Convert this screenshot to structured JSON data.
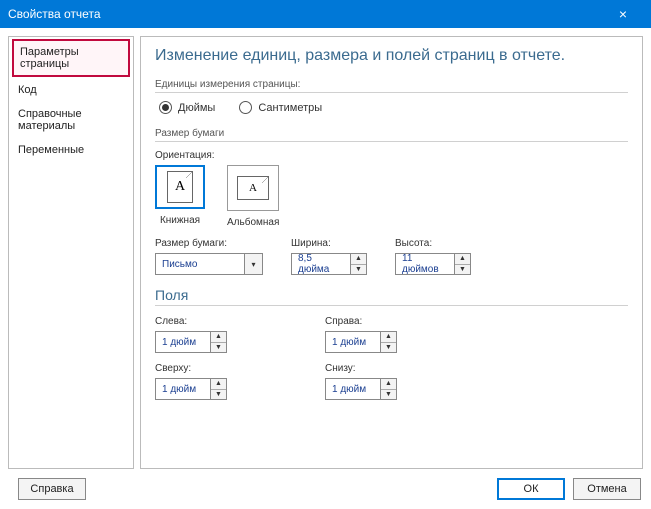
{
  "titlebar": {
    "title": "Свойства отчета"
  },
  "sidebar": {
    "items": [
      {
        "label": "Параметры страницы"
      },
      {
        "label": "Код"
      },
      {
        "label": "Справочные материалы"
      },
      {
        "label": "Переменные"
      }
    ]
  },
  "main": {
    "heading": "Изменение единиц, размера и полей страниц в отчете.",
    "units": {
      "group_label": "Единицы измерения страницы:",
      "inches": "Дюймы",
      "centimeters": "Сантиметры"
    },
    "paper": {
      "group_label": "Размер бумаги",
      "orientation_label": "Ориентация:",
      "portrait": "Книжная",
      "landscape": "Альбомная",
      "size_label": "Размер бумаги:",
      "size_value": "Письмо",
      "width_label": "Ширина:",
      "width_value": "8,5 дюйма",
      "height_label": "Высота:",
      "height_value": "11 дюймов"
    },
    "margins": {
      "title": "Поля",
      "left_label": "Слева:",
      "left_value": "1 дюйм",
      "right_label": "Справа:",
      "right_value": "1 дюйм",
      "top_label": "Сверху:",
      "top_value": "1 дюйм",
      "bottom_label": "Снизу:",
      "bottom_value": "1 дюйм"
    }
  },
  "footer": {
    "help": "Справка",
    "ok": "ОК",
    "cancel": "Отмена"
  }
}
